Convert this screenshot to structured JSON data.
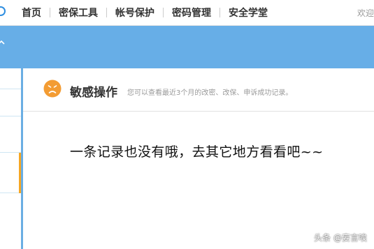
{
  "nav": {
    "items": [
      {
        "label": "首页"
      },
      {
        "label": "密保工具"
      },
      {
        "label": "帐号保护"
      },
      {
        "label": "密码管理"
      },
      {
        "label": "安全学堂"
      }
    ],
    "welcome": "欢迎"
  },
  "panel": {
    "title": "敏感操作",
    "description": "您可以查看最近3个月的改密、改保、申诉成功记录。",
    "empty_message": "一条记录也没有哦，去其它地方看看吧~~",
    "icon": "sad-face-icon"
  },
  "watermark": "头条 @妄言唉",
  "colors": {
    "banner": "#67aee7",
    "divider": "#6aaee3",
    "active_marker": "#f5a623",
    "icon_orange": "#f39c33"
  }
}
